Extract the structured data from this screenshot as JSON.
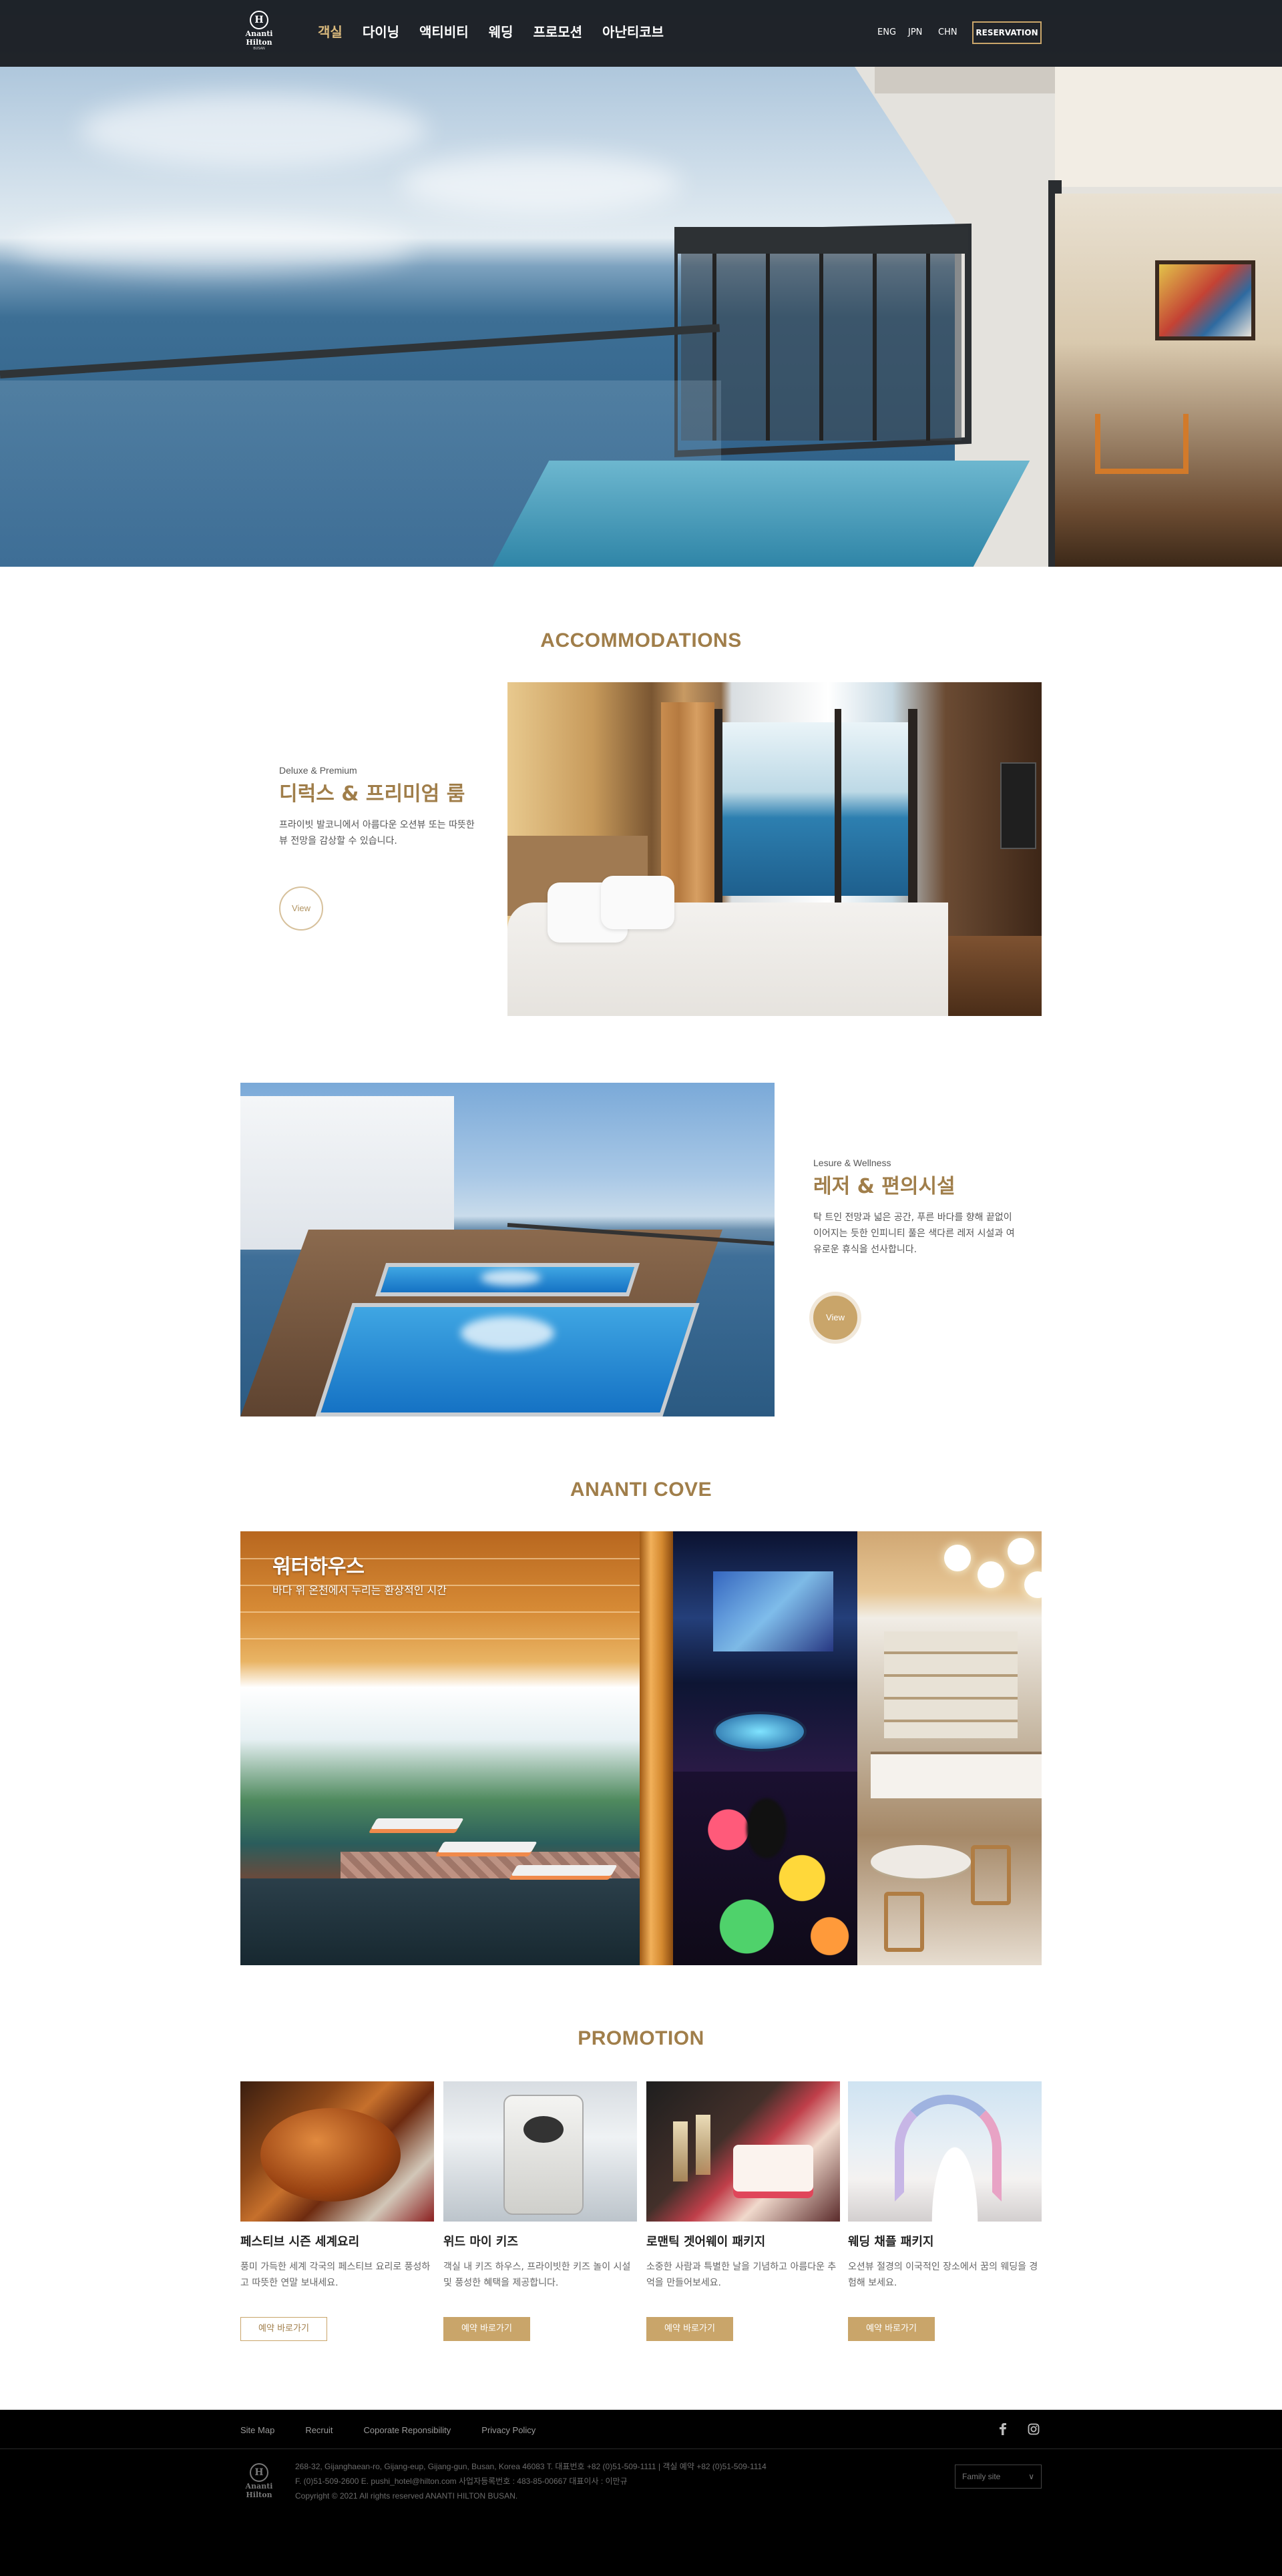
{
  "header": {
    "logo": {
      "mark": "H",
      "line1": "Ananti",
      "line2": "Hilton",
      "line3": "BUSAN"
    },
    "nav": [
      "객실",
      "다이닝",
      "액티비티",
      "웨딩",
      "프로모션",
      "아난티코브"
    ],
    "active_nav": "객실",
    "languages": [
      "ENG",
      "JPN",
      "CHN"
    ],
    "reservation_label": "RESERVATION"
  },
  "accommodations": {
    "title": "ACCOMMODATIONS",
    "items": [
      {
        "label": "Deluxe & Premium",
        "title": "디럭스 & 프리미엄 룸",
        "description": "프라이빗 발코니에서 아름다운 오션뷰 또는 따뜻한 뷰 전망을 감상할 수 있습니다.",
        "view_label": "View"
      },
      {
        "label": "Lesure & Wellness",
        "title": "레저 & 편의시설",
        "description": "탁 트인 전망과 넓은 공간, 푸른 바다를 향해 끝없이 이어지는 듯한 인피니티 풀은 색다른 레저 시설과 여유로운 휴식을 선사합니다.",
        "view_label": "View"
      }
    ]
  },
  "cove": {
    "title": "ANANTI COVE",
    "feature_title": "워터하우스",
    "feature_subtitle": "바다 위 온천에서 누리는 환상적인 시간"
  },
  "promotion": {
    "title": "PROMOTION",
    "items": [
      {
        "name": "페스티브 시즌 세계요리",
        "description": "풍미 가득한 세계 각국의 페스티브 요리로 풍성하고 따뜻한 연말 보내세요.",
        "button": "예약 바로가기",
        "style": "outline"
      },
      {
        "name": "위드 마이 키즈",
        "description": "객실 내 키즈 하우스, 프라이빗한 키즈 놀이 시설 및 풍성한 혜택을 제공합니다.",
        "button": "예약 바로가기",
        "style": "filled"
      },
      {
        "name": "로맨틱 겟어웨이 패키지",
        "description": "소중한 사람과 특별한 날을 기념하고 아름다운 추억을 만들어보세요.",
        "button": "예약 바로가기",
        "style": "filled"
      },
      {
        "name": "웨딩 채플 패키지",
        "description": "오션뷰 절경의 이국적인 장소에서 꿈의 웨딩을 경험해 보세요.",
        "button": "예약 바로가기",
        "style": "filled"
      }
    ]
  },
  "footer": {
    "links": [
      "Site Map",
      "Recruit",
      "Coporate Reponsibility",
      "Privacy Policy"
    ],
    "social": [
      "facebook-icon",
      "instagram-icon"
    ],
    "address": "268-32, Gijanghaean-ro, Gijang-eup, Gijang-gun, Busan, Korea 46083  T. 대표번호 +82 (0)51-509-1111 | 객실 예약 +82 (0)51-509-1114",
    "contact": "F. (0)51-509-2600 E. pushi_hotel@hilton.com 사업자등록번호 : 483-85-00667 대표이사 : 이만규",
    "copyright": "Copyright © 2021 All rights reserved ANANTI HILTON BUSAN.",
    "family_site": "Family site",
    "family_arrow": "∨"
  },
  "colors": {
    "accent": "#a07e4a",
    "gold": "#c9a56a",
    "header_bg": "#14161a",
    "footer_bg": "#000000"
  }
}
